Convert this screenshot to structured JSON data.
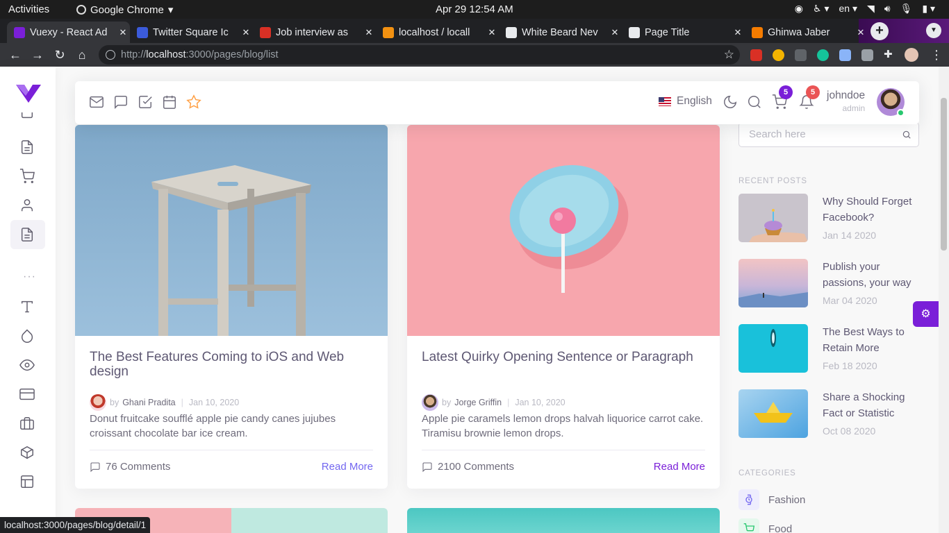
{
  "os": {
    "activities": "Activities",
    "app_name": "Google Chrome",
    "clock": "Apr 29  12:54 AM",
    "lang": "en"
  },
  "browser": {
    "tabs": [
      {
        "title": "Vuexy - React Ad",
        "fav_color": "#7a1fd8",
        "active": true
      },
      {
        "title": "Twitter Square Ic",
        "fav_color": "#3b5bdb",
        "active": false
      },
      {
        "title": "Job interview as",
        "fav_color": "#d93025",
        "active": false
      },
      {
        "title": "localhost / locall",
        "fav_color": "#f29111",
        "active": false
      },
      {
        "title": "White Beard Nev",
        "fav_color": "#e8eaed",
        "active": false
      },
      {
        "title": "Page Title",
        "fav_color": "#e8eaed",
        "active": false
      },
      {
        "title": "Ghinwa Jaber",
        "fav_color": "#f57c00",
        "active": false
      }
    ],
    "url_prefix": "http://",
    "url_host": "localhost",
    "url_path": ":3000/pages/blog/list",
    "status_url": "localhost:3000/pages/blog/detail/1"
  },
  "navbar": {
    "language": "English",
    "cart_count": "5",
    "notif_count": "5",
    "user_name": "johndoe",
    "user_role": "admin",
    "icons": [
      "mail-icon",
      "chat-icon",
      "todo-icon",
      "calendar-icon",
      "star-icon"
    ]
  },
  "posts": [
    {
      "title": "The Best Features Coming to iOS and Web design",
      "by": "by",
      "author": "Ghani Pradita",
      "date": "Jan 10, 2020",
      "excerpt": "Donut fruitcake soufflé apple pie candy canes jujubes croissant chocolate bar ice cream.",
      "comments": "76 Comments",
      "read_more": "Read More"
    },
    {
      "title": "Latest Quirky Opening Sentence or Paragraph",
      "by": "by",
      "author": "Jorge Griffin",
      "date": "Jan 10, 2020",
      "excerpt": "Apple pie caramels lemon drops halvah liquorice carrot cake. Tiramisu brownie lemon drops.",
      "comments": "2100 Comments",
      "read_more": "Read More"
    }
  ],
  "right": {
    "search_placeholder": "Search here",
    "recent_heading": "RECENT POSTS",
    "recent": [
      {
        "title": "Why Should Forget Facebook?",
        "date": "Jan 14 2020"
      },
      {
        "title": "Publish your passions, your way",
        "date": "Mar 04 2020"
      },
      {
        "title": "The Best Ways to Retain More",
        "date": "Feb 18 2020"
      },
      {
        "title": "Share a Shocking Fact or Statistic",
        "date": "Oct 08 2020"
      }
    ],
    "categories_heading": "CATEGORIES",
    "categories": [
      {
        "label": "Fashion",
        "color": "#7367f0"
      },
      {
        "label": "Food",
        "color": "#28c76f"
      }
    ]
  }
}
